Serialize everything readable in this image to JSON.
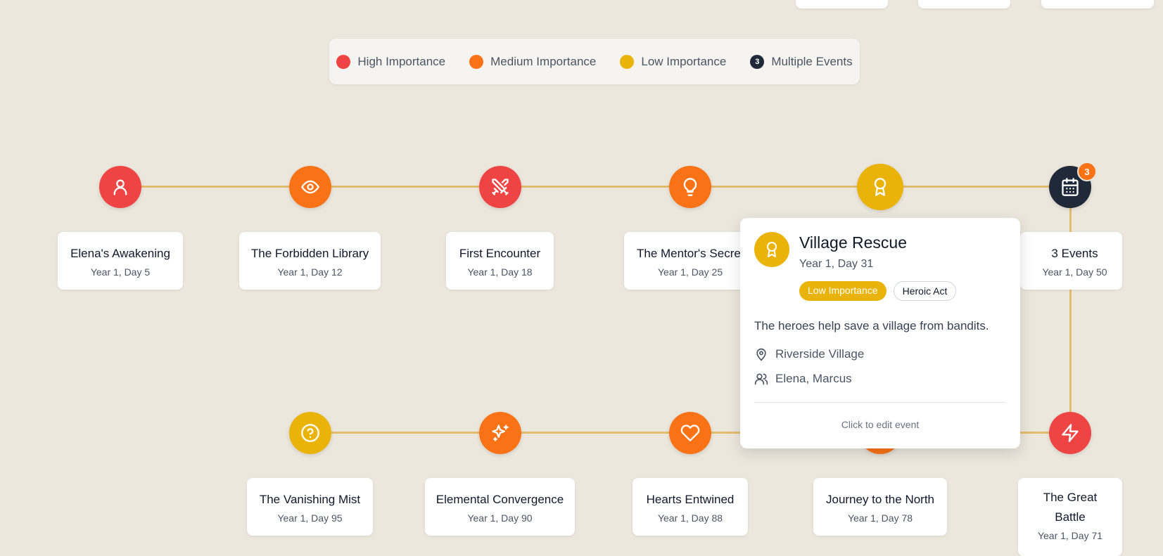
{
  "legend": {
    "items": [
      {
        "label": "High Importance",
        "color": "#ef4444"
      },
      {
        "label": "Medium Importance",
        "color": "#f97316"
      },
      {
        "label": "Low Importance",
        "color": "#eab308"
      },
      {
        "label": "Multiple Events",
        "color": "#1f2937",
        "count": "3"
      }
    ]
  },
  "events_row1": [
    {
      "title": "Elena's Awakening",
      "date": "Year 1, Day 5",
      "icon": "user-icon",
      "color": "#ef4444"
    },
    {
      "title": "The Forbidden Library",
      "date": "Year 1, Day 12",
      "icon": "eye-icon",
      "color": "#f97316"
    },
    {
      "title": "First Encounter",
      "date": "Year 1, Day 18",
      "icon": "crossed-swords-icon",
      "color": "#ef4444"
    },
    {
      "title": "The Mentor's Secret",
      "date": "Year 1, Day 25",
      "icon": "lightbulb-icon",
      "color": "#f97316"
    },
    {
      "title": "Village Rescue",
      "date": "Year 1, Day 31",
      "icon": "award-icon",
      "color": "#eab308"
    },
    {
      "title": "3 Events",
      "date": "Year 1, Day 50",
      "icon": "calendar-icon",
      "color": "#1f2937",
      "badge": "3"
    }
  ],
  "events_row2": [
    {
      "title": "The Vanishing Mist",
      "date": "Year 1, Day 95",
      "icon": "question-icon",
      "color": "#eab308"
    },
    {
      "title": "Elemental Convergence",
      "date": "Year 1, Day 90",
      "icon": "sparkles-icon",
      "color": "#f97316"
    },
    {
      "title": "Hearts Entwined",
      "date": "Year 1, Day 88",
      "icon": "heart-icon",
      "color": "#f97316"
    },
    {
      "title": "Journey to the North",
      "date": "Year 1, Day 78",
      "icon": "compass-icon",
      "color": "#f97316"
    },
    {
      "title": "The Great Battle",
      "date": "Year 1, Day 71",
      "icon": "lightning-icon",
      "color": "#ef4444"
    }
  ],
  "popup": {
    "title": "Village Rescue",
    "date": "Year 1, Day 31",
    "importance_tag": "Low Importance",
    "type_tag": "Heroic Act",
    "description": "The heroes help save a village from bandits.",
    "location": "Riverside Village",
    "characters": "Elena, Marcus",
    "footer": "Click to edit event"
  }
}
